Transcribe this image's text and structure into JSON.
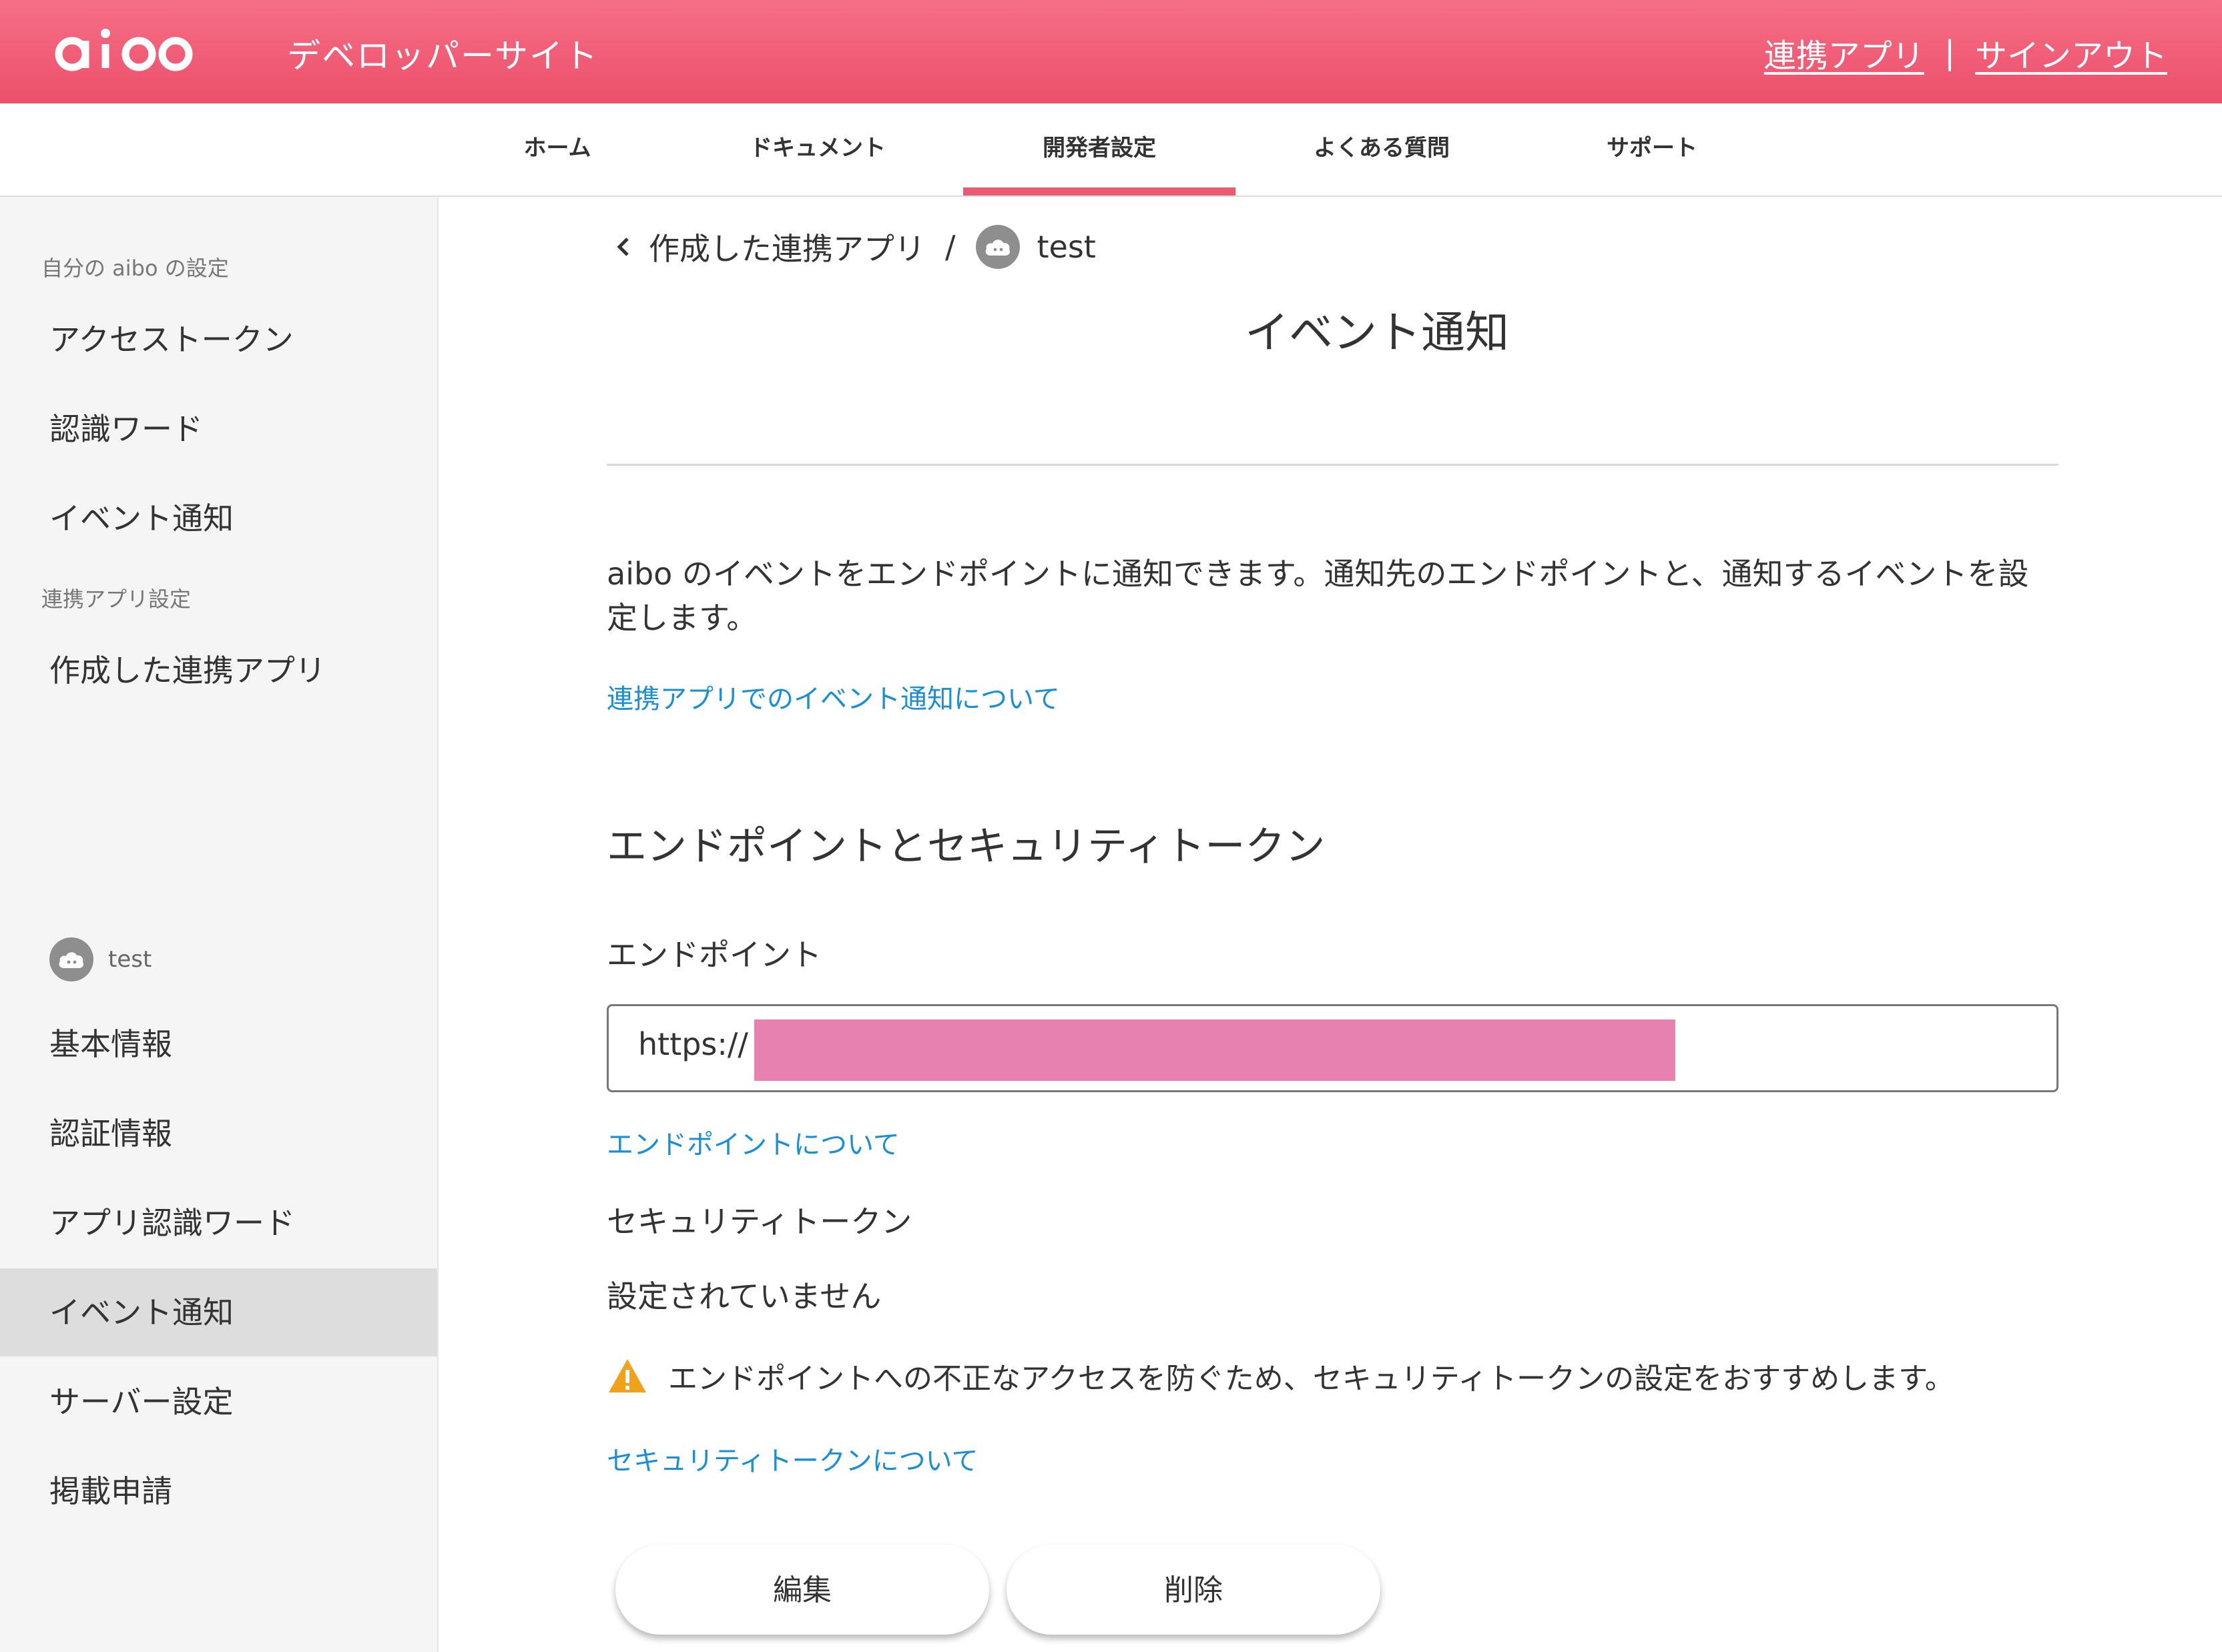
{
  "header": {
    "logo_text": "aibo",
    "site_title": "デベロッパーサイト",
    "links": [
      "連携アプリ",
      "サインアウト"
    ],
    "separator": "|"
  },
  "nav": {
    "items": [
      {
        "label": "ホーム",
        "active": false
      },
      {
        "label": "ドキュメント",
        "active": false
      },
      {
        "label": "開発者設定",
        "active": true
      },
      {
        "label": "よくある質問",
        "active": false
      },
      {
        "label": "サポート",
        "active": false
      }
    ]
  },
  "sidebar": {
    "section1": "自分の aibo の設定",
    "section1_items": [
      "アクセストークン",
      "認識ワード",
      "イベント通知"
    ],
    "section2": "連携アプリ設定",
    "section2_items": [
      "作成した連携アプリ"
    ],
    "app_name": "test",
    "app_items": [
      "基本情報",
      "認証情報",
      "アプリ認識ワード",
      "イベント通知",
      "サーバー設定",
      "掲載申請"
    ],
    "active_item": "イベント通知"
  },
  "breadcrumb": {
    "parent": "作成した連携アプリ",
    "separator": "/",
    "current": "test"
  },
  "page": {
    "title": "イベント通知",
    "intro": "aibo のイベントをエンドポイントに通知できます。通知先のエンドポイントと、通知するイベントを設定します。",
    "intro_link": "連携アプリでのイベント通知について",
    "section_heading": "エンドポイントとセキュリティトークン",
    "endpoint_label": "エンドポイント",
    "endpoint_value": "https://",
    "endpoint_link": "エンドポイントについて",
    "token_label": "セキュリティトークン",
    "token_value": "設定されていません",
    "warning": "エンドポイントへの不正なアクセスを防ぐため、セキュリティトークンの設定をおすすめします。",
    "token_link": "セキュリティトークンについて",
    "edit_button": "編集",
    "delete_button": "削除"
  },
  "colors": {
    "brand": "#ec5a72",
    "link": "#1a8fd6",
    "warning": "#f0a31a",
    "redaction": "#e781b0"
  }
}
